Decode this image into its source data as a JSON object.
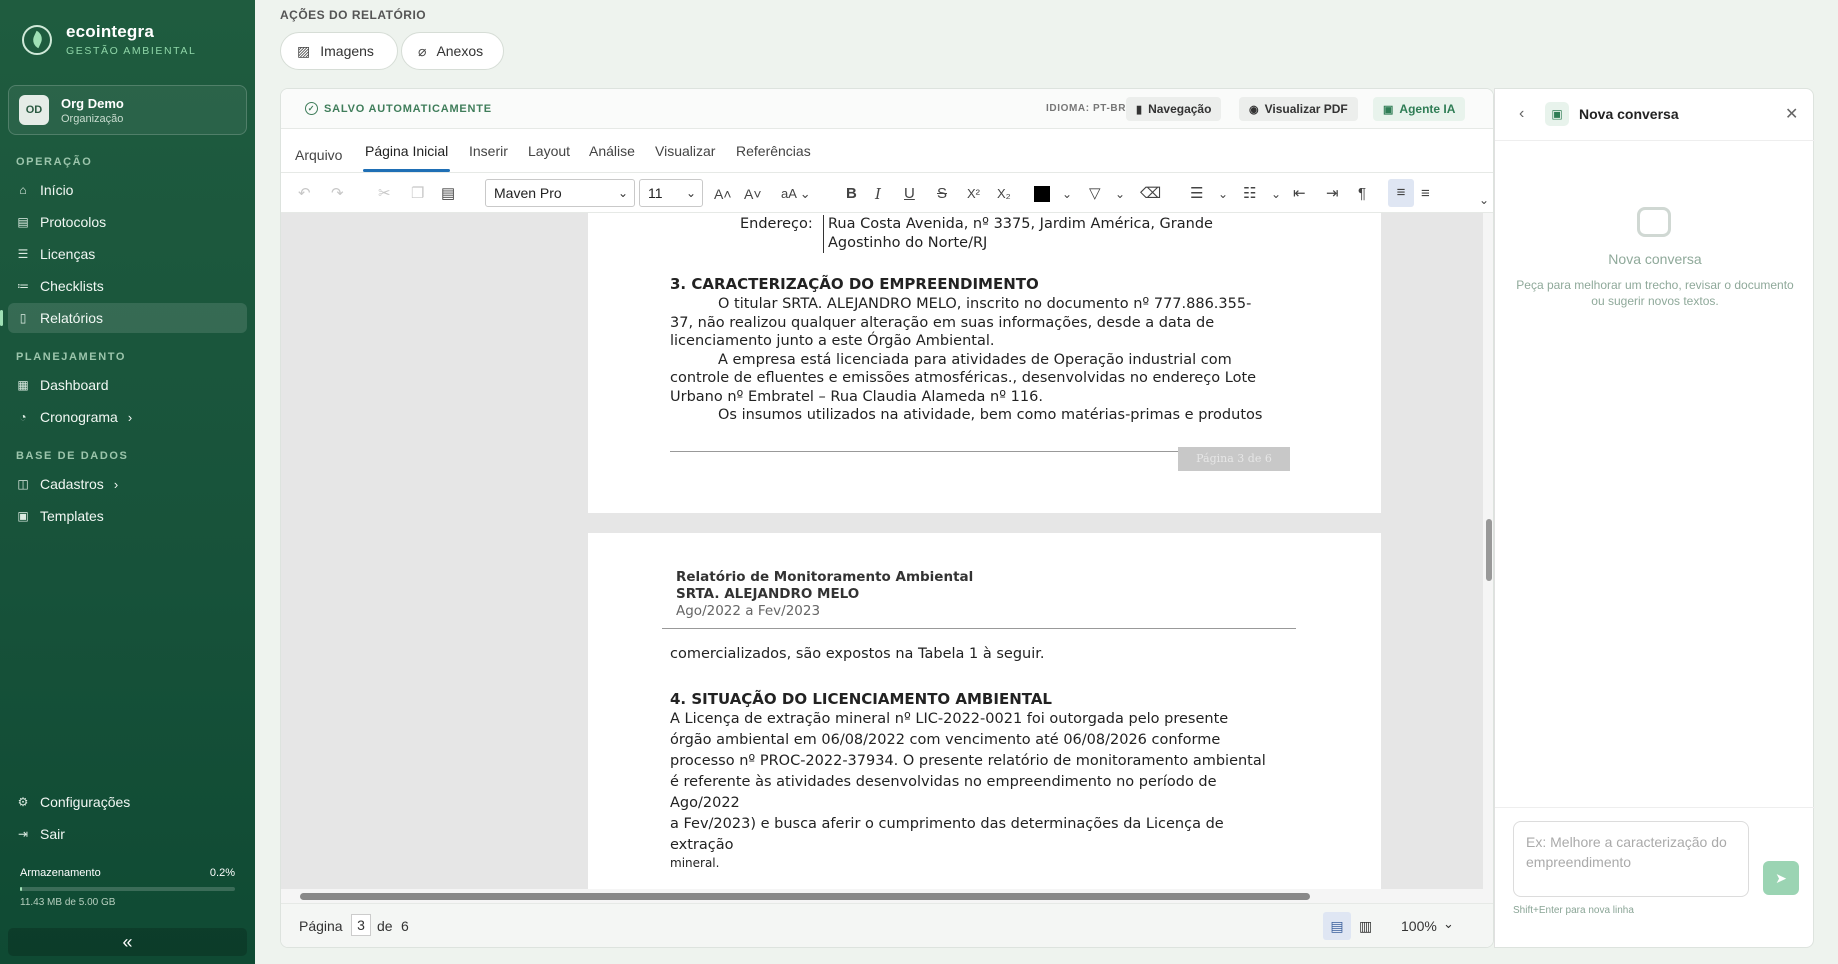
{
  "app": {
    "name": "ecointegra",
    "tagline": "GESTÃO AMBIENTAL"
  },
  "org": {
    "initials": "OD",
    "name": "Org Demo",
    "role": "Organização"
  },
  "sidebar": {
    "sections": [
      {
        "title": "OPERAÇÃO"
      },
      {
        "title": "PLANEJAMENTO"
      },
      {
        "title": "BASE DE DADOS"
      }
    ],
    "items": [
      {
        "label": "Início",
        "icon": "home-icon"
      },
      {
        "label": "Protocolos",
        "icon": "document-icon"
      },
      {
        "label": "Licenças",
        "icon": "license-icon"
      },
      {
        "label": "Checklists",
        "icon": "checklist-icon"
      },
      {
        "label": "Relatórios",
        "icon": "book-icon",
        "active": true
      },
      {
        "label": "Dashboard",
        "icon": "grid-icon"
      },
      {
        "label": "Cronograma",
        "icon": "timeline-icon"
      },
      {
        "label": "Cadastros",
        "icon": "database-icon"
      },
      {
        "label": "Templates",
        "icon": "template-icon"
      }
    ],
    "footer": [
      {
        "label": "Configurações",
        "icon": "gear-icon"
      },
      {
        "label": "Sair",
        "icon": "logout-icon"
      }
    ],
    "storage": {
      "label": "Armazenamento",
      "percent": "0.2%",
      "fraction": 0.002,
      "used": "11.43 MB de 5.00 GB"
    },
    "collapse_glyph": "«"
  },
  "actions": {
    "title": "AÇÕES DO RELATÓRIO",
    "images": "Imagens",
    "attachments": "Anexos"
  },
  "editor": {
    "saved": "SALVO AUTOMATICAMENTE",
    "language": "IDIOMA: PT-BR",
    "nav_button": "Navegação",
    "pdf_button": "Visualizar PDF",
    "ai_button": "Agente IA",
    "tabs": [
      "Arquivo",
      "Página Inicial",
      "Inserir",
      "Layout",
      "Análise",
      "Visualizar",
      "Referências"
    ],
    "active_tab": "Página Inicial",
    "font": "Maven Pro",
    "font_size": "11",
    "page1": {
      "address_label": "Endereço:",
      "address_line1": "Rua Costa Avenida, nº 3375, Jardim América, Grande",
      "address_line2": "Agostinho do Norte/RJ",
      "heading": "3.   CARACTERIZAÇÃO DO EMPREENDIMENTO",
      "lines": [
        "O titular SRTA. ALEJANDRO MELO, inscrito no documento nº 777.886.355-",
        "37, não realizou qualquer alteração em suas informações, desde a data de",
        "licenciamento junto a este Órgão Ambiental.",
        "A empresa está licenciada para atividades de Operação industrial com",
        "controle de efluentes e emissões atmosféricas., desenvolvidas no endereço Lote",
        "Urbano nº Embratel – Rua Claudia Alameda nº 116.",
        "Os insumos utilizados na atividade, bem como matérias-primas e produtos"
      ],
      "page_badge": "Página 3 de 6"
    },
    "page2": {
      "header_title": "Relatório de Monitoramento Ambiental",
      "header_name": "SRTA. ALEJANDRO MELO",
      "header_period": "Ago/2022 a Fev/2023",
      "first_line": "comercializados, são expostos na Tabela 1 à seguir.",
      "heading": "4.   SITUAÇÃO DO LICENCIAMENTO AMBIENTAL",
      "lines": [
        "A Licença de extração mineral nº LIC-2022-0021 foi outorgada pelo presente",
        "órgão ambiental em 06/08/2022 com vencimento até 06/08/2026 conforme",
        "processo nº PROC-2022-37934. O presente relatório de monitoramento ambiental",
        "é referente às atividades desenvolvidas no empreendimento no período de Ago/2022",
        "a Fev/2023) e busca aferir o cumprimento das determinações da Licença de extração",
        "mineral."
      ]
    },
    "status": {
      "page_label": "Página",
      "page": "3",
      "of_label": "de",
      "total": "6",
      "zoom": "100%"
    }
  },
  "ai": {
    "title": "Nova conversa",
    "empty_title": "Nova conversa",
    "empty_sub": "Peça para melhorar um trecho, revisar o documento ou sugerir novos textos.",
    "placeholder": "Ex: Melhore a caracterização do empreendimento",
    "hint": "Shift+Enter para nova linha"
  }
}
